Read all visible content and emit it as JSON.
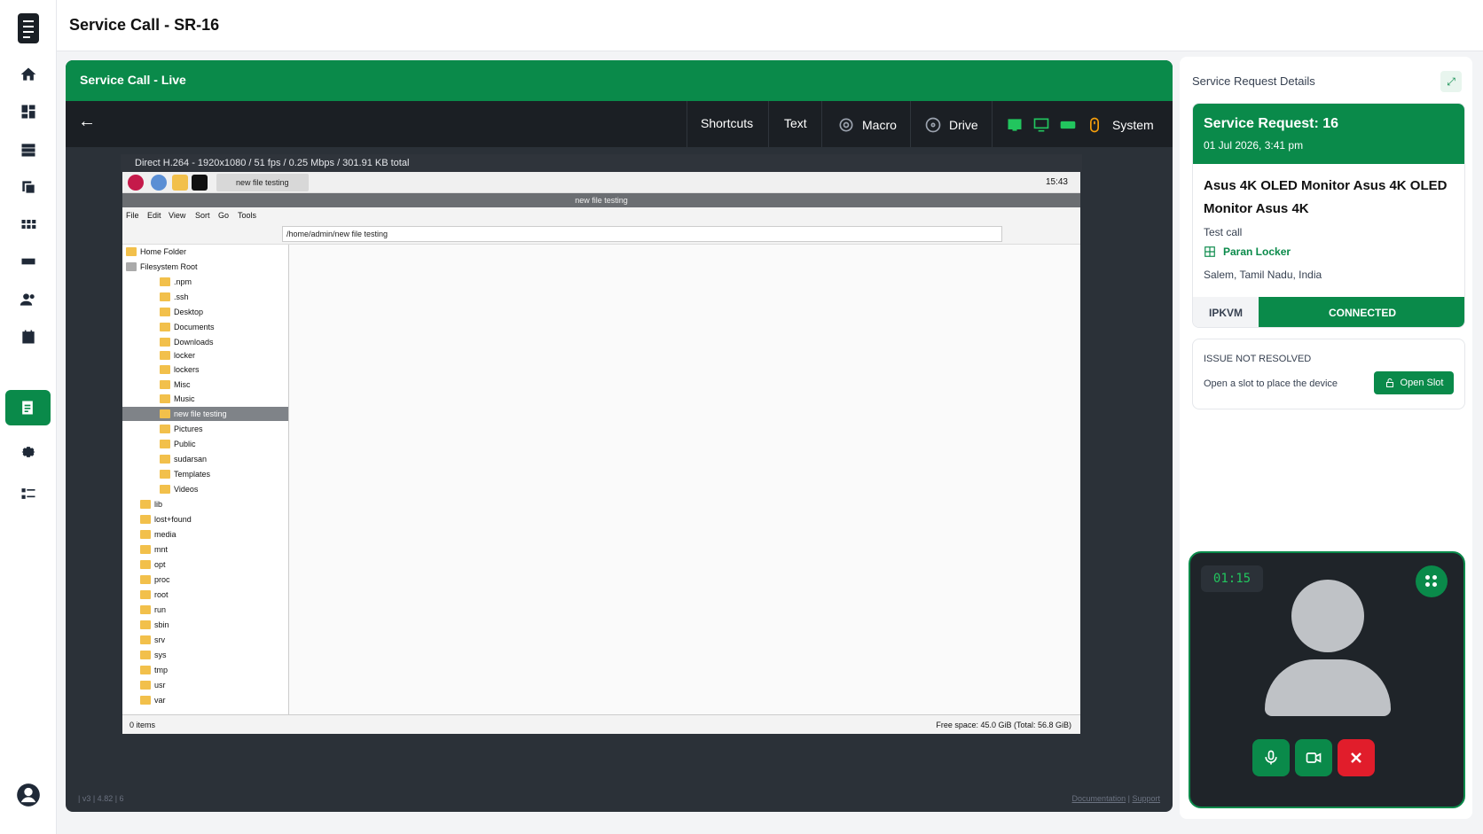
{
  "page": {
    "title": "Service Call - SR-16"
  },
  "live": {
    "header": "Service Call - Live",
    "toolbar": {
      "shortcuts": "Shortcuts",
      "text": "Text",
      "macro": "Macro",
      "drive": "Drive",
      "system": "System"
    },
    "stream_info": "Direct H.264 - 1920x1080 / 51 fps / 0.25 Mbps / 301.91 KB total",
    "pi": {
      "tab": "new file testing",
      "clock": "15:43"
    },
    "fm": {
      "title": "new file testing",
      "menu": [
        "File",
        "Edit",
        "View",
        "Sort",
        "Go",
        "Tools"
      ],
      "path": "/home/admin/new file testing",
      "tree": [
        "Home Folder",
        "Filesystem Root",
        ".npm",
        ".ssh",
        "Desktop",
        "Documents",
        "Downloads",
        "locker",
        "lockers",
        "Misc",
        "Music",
        "new file testing",
        "Pictures",
        "Public",
        "sudarsan",
        "Templates",
        "Videos",
        "lib",
        "lost+found",
        "media",
        "mnt",
        "opt",
        "proc",
        "root",
        "run",
        "sbin",
        "srv",
        "sys",
        "tmp",
        "usr",
        "var"
      ],
      "status_left": "0 items",
      "status_right": "Free space: 45.0 GiB (Total: 56.8 GiB)"
    },
    "footer_left": "| v3 | 4.82 | 6",
    "footer_doc": "Documentation",
    "footer_sep": "|",
    "footer_support": "Support"
  },
  "panel": {
    "title": "Service Request Details",
    "request": {
      "title": "Service Request: 16",
      "date": "01 Jul 2026, 3:41 pm",
      "device": "Asus 4K OLED Monitor Asus 4K OLED Monitor Asus 4K",
      "description": "Test call",
      "locker": "Paran Locker",
      "location": "Salem, Tamil Nadu, India",
      "conn_type": "IPKVM",
      "conn_status": "CONNECTED"
    },
    "issue": {
      "title": "ISSUE NOT RESOLVED",
      "text": "Open a slot to place the device",
      "button": "Open Slot"
    },
    "video": {
      "timer": "01:15"
    }
  },
  "colors": {
    "accent": "#0a8a4a",
    "danger": "#e11d2b",
    "dark": "#1b1f24"
  }
}
